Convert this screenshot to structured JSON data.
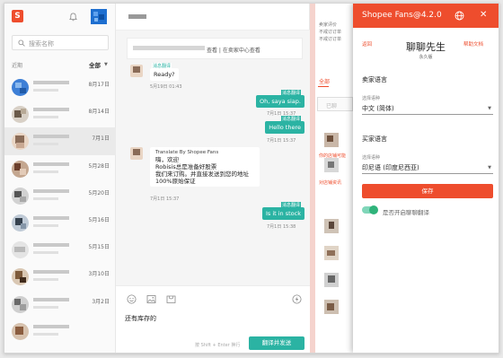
{
  "sidebar": {
    "search_placeholder": "搜索名称",
    "recent_label": "近期",
    "filter_label": "全部",
    "conversations": [
      {
        "date": "8月17日"
      },
      {
        "date": "8月14日"
      },
      {
        "date": "7月1日"
      },
      {
        "date": "5月28日"
      },
      {
        "date": "5月20日"
      },
      {
        "date": "5月16日"
      },
      {
        "date": "5月15日"
      },
      {
        "date": "3月10日"
      },
      {
        "date": "3月2日"
      },
      {
        "date": ""
      }
    ]
  },
  "chat": {
    "order_card_link": "查看 | 在卖家中心查看",
    "messages": [
      {
        "tag": "消息翻译",
        "text": "Ready?",
        "time": "5月19日 01:43"
      },
      {
        "tag": "消息翻译",
        "text": "Oh, saya siap.",
        "time": "7月1日 15:37"
      },
      {
        "tag": "消息翻译",
        "text": "Hello there",
        "time": "7月1日 15:37"
      },
      {
        "tag": "Translate By Shopee Fans",
        "lines": [
          "嗨，欢迎",
          "Robisis总是准备好股票",
          "我们来订购。并直接发送到您的地址",
          "100%原始保证"
        ],
        "time": "7月1日 15:37"
      },
      {
        "tag": "消息翻译",
        "text": "Is it in stock",
        "time": "7月1日 15:38"
      }
    ],
    "draft": "还有库存的",
    "hint": "按 Shift + Enter 换行",
    "send_label": "翻译并发送"
  },
  "background_page": {
    "lines": [
      "卖家评价",
      "不戒订订单",
      "不戒订订单"
    ],
    "tab_all": "全部",
    "search_placeholder": "已聊",
    "promo_lines": [
      "你的店铺可能",
      "对店铺资讯"
    ]
  },
  "extension": {
    "title": "Shopee Fans@4.2.0",
    "back_label": "返回",
    "help_label": "帮助文档",
    "brand": "聊聊先生",
    "brand_sub": "永久版",
    "seller_section": "卖家语言",
    "seller_field_label": "选择语种",
    "seller_language": "中文 (简体)",
    "buyer_section": "买家语言",
    "buyer_field_label": "选择语种",
    "buyer_language": "印尼语 (印度尼西亚)",
    "save_label": "保存",
    "toggle_label": "是否开启聊聊翻译",
    "toggle_on": true
  },
  "colors": {
    "brand_orange": "#ee4d2d",
    "chat_teal": "#2bb3a3",
    "toggle_green": "#2fb37a"
  }
}
